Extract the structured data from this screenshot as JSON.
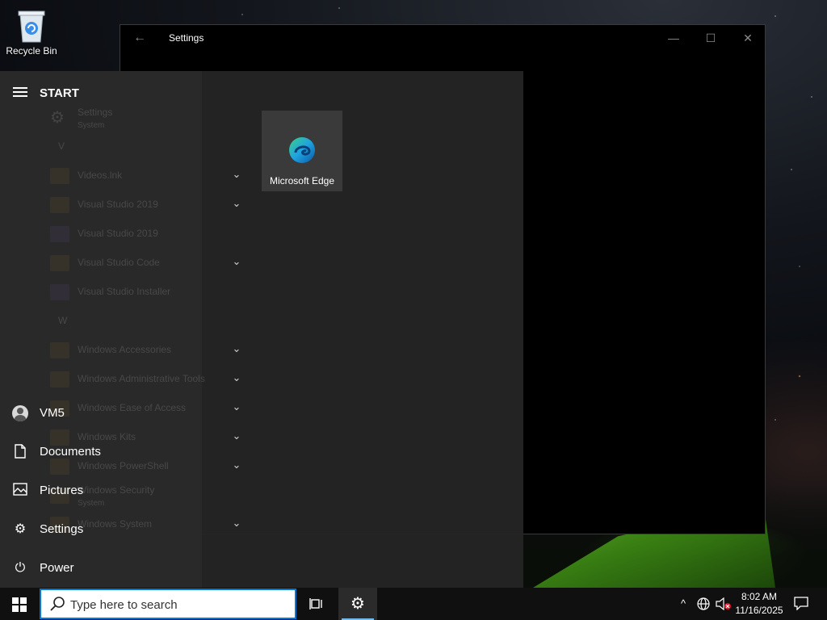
{
  "desktop": {
    "recycle_bin_label": "Recycle Bin"
  },
  "settings_window": {
    "title": "Settings",
    "back_glyph": "←",
    "minimize_glyph": "—",
    "maximize_glyph": "☐",
    "close_glyph": "✕"
  },
  "start_menu": {
    "heading": "START",
    "rail": {
      "user": "VM5",
      "documents": "Documents",
      "pictures": "Pictures",
      "settings": "Settings",
      "power": "Power"
    },
    "app_list": [
      {
        "name": "Settings",
        "sub": "System",
        "icon": "gear-icon",
        "expand": false
      },
      {
        "letter": "V"
      },
      {
        "name": "Videos.lnk",
        "icon": "folder-icon",
        "expand": true
      },
      {
        "name": "Visual Studio 2019",
        "icon": "folder-icon",
        "expand": true
      },
      {
        "name": "Visual Studio 2019",
        "icon": "visual-studio-icon",
        "expand": false
      },
      {
        "name": "Visual Studio Code",
        "icon": "folder-icon",
        "expand": true
      },
      {
        "name": "Visual Studio Installer",
        "icon": "visual-studio-icon",
        "expand": false
      },
      {
        "letter": "W"
      },
      {
        "name": "Windows Accessories",
        "icon": "folder-icon",
        "expand": true
      },
      {
        "name": "Windows Administrative Tools",
        "icon": "folder-icon",
        "expand": true
      },
      {
        "name": "Windows Ease of Access",
        "icon": "folder-icon",
        "expand": true
      },
      {
        "name": "Windows Kits",
        "icon": "folder-icon",
        "expand": true
      },
      {
        "name": "Windows PowerShell",
        "icon": "folder-icon",
        "expand": true
      },
      {
        "name": "Windows Security",
        "sub": "System",
        "icon": "shield-icon",
        "expand": false
      },
      {
        "name": "Windows System",
        "icon": "folder-icon",
        "expand": true
      }
    ],
    "tiles": [
      {
        "label": "Microsoft Edge",
        "icon": "edge-icon"
      }
    ]
  },
  "taskbar": {
    "search_placeholder": "Type here to search",
    "time": "8:02 AM",
    "date": "11/16/2025",
    "tray_chevron": "^"
  },
  "colors": {
    "accent": "#0078d7",
    "start_bg": "#242424",
    "taskbar_bg": "#101010"
  }
}
